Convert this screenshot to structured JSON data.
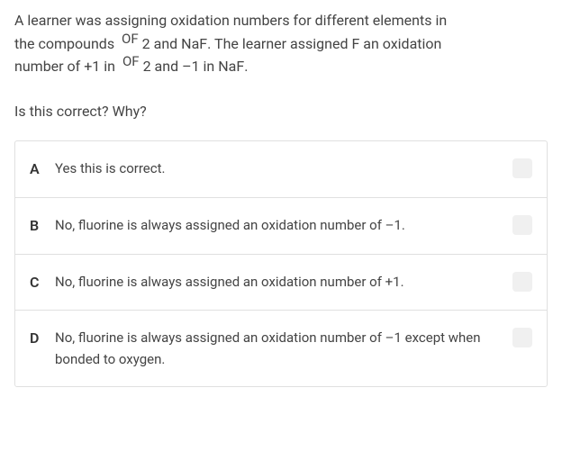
{
  "question": {
    "line1_part1": "A learner was assigning oxidation numbers for different elements in",
    "line2_part1": "the compounds ",
    "formula1_top": "OF",
    "formula1_sub": "2",
    "line2_part2": " and ",
    "naf": "NaF",
    "line2_part3": ". The learner assigned F an oxidation",
    "line3_part1": "number of +1 in ",
    "formula2_top": "OF",
    "formula2_sub": "2",
    "line3_part2": " and –1 in ",
    "naf2": "NaF",
    "line3_part3": "."
  },
  "prompt": "Is this correct? Why?",
  "options": [
    {
      "letter": "A",
      "text": "Yes this is correct."
    },
    {
      "letter": "B",
      "text": "No, fluorine is always assigned an oxidation number of –1."
    },
    {
      "letter": "C",
      "text": "No, fluorine is always assigned an oxidation number of +1."
    },
    {
      "letter": "D",
      "text": "No, fluorine is always assigned an oxidation number of –1 except when bonded to oxygen."
    }
  ]
}
